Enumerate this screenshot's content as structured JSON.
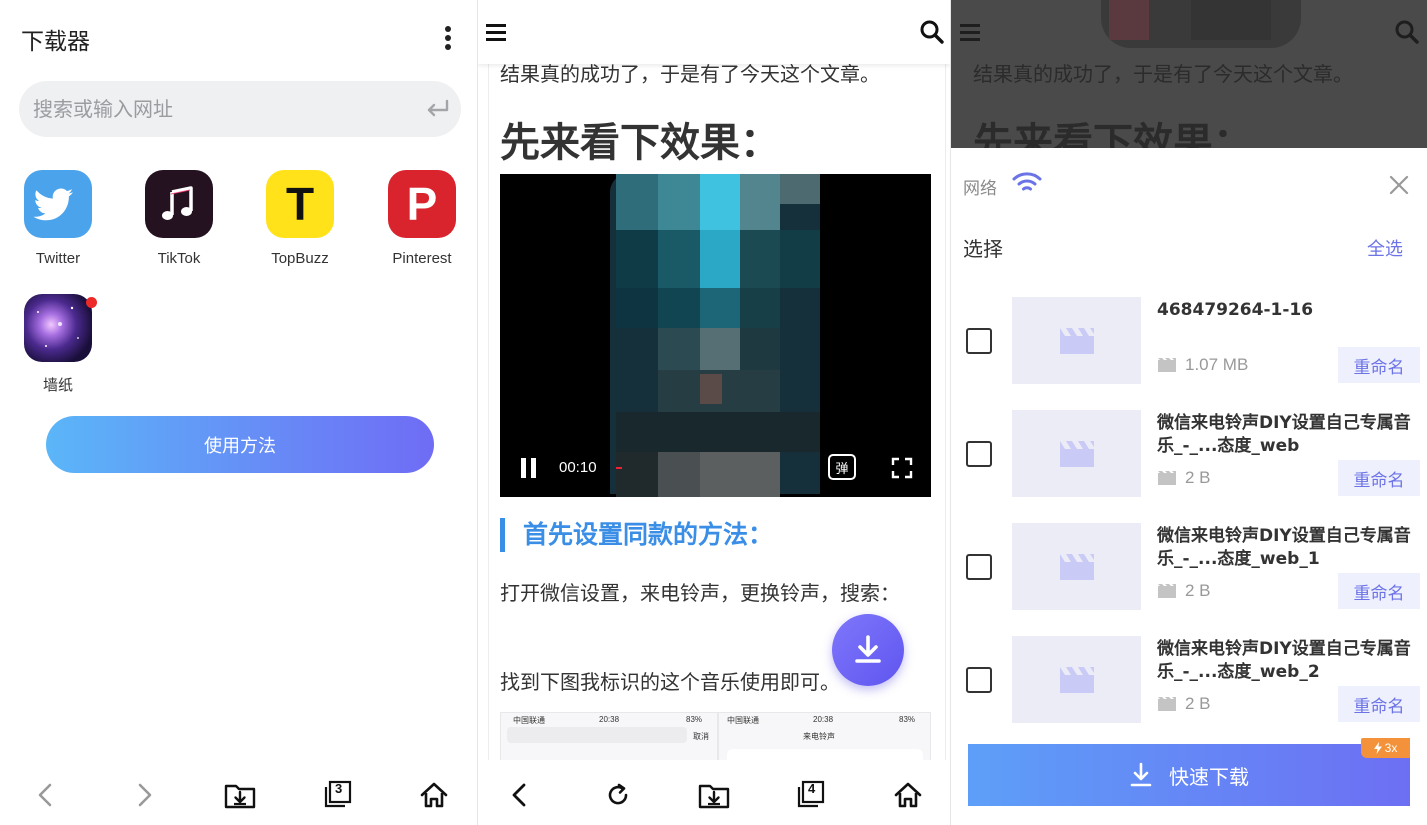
{
  "panel1": {
    "title": "下载器",
    "search": {
      "placeholder": "搜索或输入网址"
    },
    "apps": [
      {
        "label": "Twitter",
        "icon": "twitter-icon"
      },
      {
        "label": "TikTok",
        "icon": "tiktok-icon"
      },
      {
        "label": "TopBuzz",
        "icon": "topbuzz-icon"
      },
      {
        "label": "Pinterest",
        "icon": "pinterest-icon"
      },
      {
        "label": "墙纸",
        "icon": "wallpaper-icon"
      }
    ],
    "topbuzz_letter": "T",
    "pinterest_letter": "P",
    "howto_label": "使用方法",
    "bottom_nav": {
      "tabs_count": "3"
    }
  },
  "panel2": {
    "cut_line": "结果真的成功了，于是有了今天这个文章。",
    "heading": "先来看下效果：",
    "video": {
      "time": "00:10",
      "danmaku_label": "弹"
    },
    "section_title": "首先设置同款的方法：",
    "para1": "打开微信设置，来电铃声，更换铃声，搜索：",
    "para2": "找到下图我标识的这个音乐使用即可。",
    "thumbs": [
      {
        "carrier": "中国联通",
        "time": "20:38",
        "battery": "83%",
        "extra": "取消"
      },
      {
        "carrier": "中国联通",
        "time": "20:38",
        "battery": "83%",
        "extra": "来电铃声"
      }
    ],
    "bottom_nav": {
      "tabs_count": "4"
    }
  },
  "panel3": {
    "ghost_line": "结果真的成功了，于是有了今天这个文章。",
    "ghost_heading": "先来看下效果：",
    "network_label": "网络",
    "select_label": "选择",
    "select_all": "全选",
    "items": [
      {
        "name": "468479264-1-16",
        "size": "1.07 MB",
        "rename": "重命名"
      },
      {
        "name": "微信来电铃声DIY设置自己专属音乐_-_...态度_web",
        "size": "2 B",
        "rename": "重命名"
      },
      {
        "name": "微信来电铃声DIY设置自己专属音乐_-_...态度_web_1",
        "size": "2 B",
        "rename": "重命名"
      },
      {
        "name": "微信来电铃声DIY设置自己专属音乐_-_...态度_web_2",
        "size": "2 B",
        "rename": "重命名"
      }
    ],
    "fast_download": "快速下载",
    "speed_badge": "3x"
  },
  "colors": {
    "accent_blue": "#3a8ee6",
    "accent_purple": "#6b73e6",
    "gradient_start": "#5bb6f8",
    "gradient_end": "#6f6cf5",
    "badge_orange": "#f3923a"
  }
}
